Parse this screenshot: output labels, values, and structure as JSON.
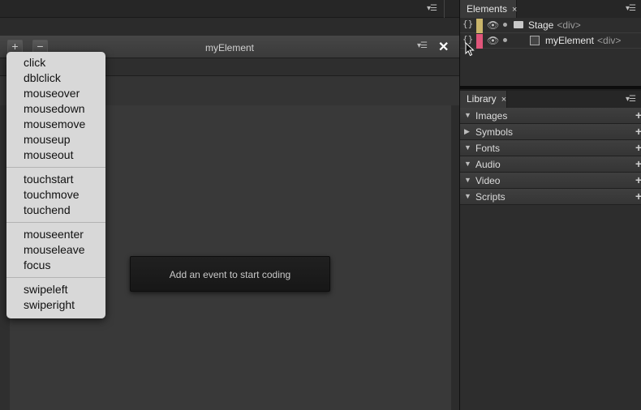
{
  "code_window": {
    "title": "myElement",
    "add_button": "+",
    "remove_button": "−",
    "close_icon": "✕",
    "hint": "Add an event to start coding"
  },
  "events_menu": {
    "groups": [
      [
        "click",
        "dblclick",
        "mouseover",
        "mousedown",
        "mousemove",
        "mouseup",
        "mouseout"
      ],
      [
        "touchstart",
        "touchmove",
        "touchend"
      ],
      [
        "mouseenter",
        "mouseleave",
        "focus"
      ],
      [
        "swipeleft",
        "swiperight"
      ]
    ]
  },
  "elements_panel": {
    "tab_label": "Elements",
    "tab_close": "×",
    "rows": [
      {
        "name": "Stage",
        "tag": "<div>",
        "color": "#c9b46a"
      },
      {
        "name": "myElement",
        "tag": "<div>",
        "color": "#e0557a"
      }
    ]
  },
  "library_panel": {
    "tab_label": "Library",
    "tab_close": "×",
    "sections": [
      {
        "label": "Images",
        "expanded": true
      },
      {
        "label": "Symbols",
        "expanded": false
      },
      {
        "label": "Fonts",
        "expanded": true
      },
      {
        "label": "Audio",
        "expanded": true
      },
      {
        "label": "Video",
        "expanded": true
      },
      {
        "label": "Scripts",
        "expanded": true
      }
    ]
  },
  "icons": {
    "panel_menu": "panel-menu-icon",
    "braces": "code-braces-icon",
    "eye": "eye-icon",
    "cursor": "mouse-pointer-icon"
  }
}
